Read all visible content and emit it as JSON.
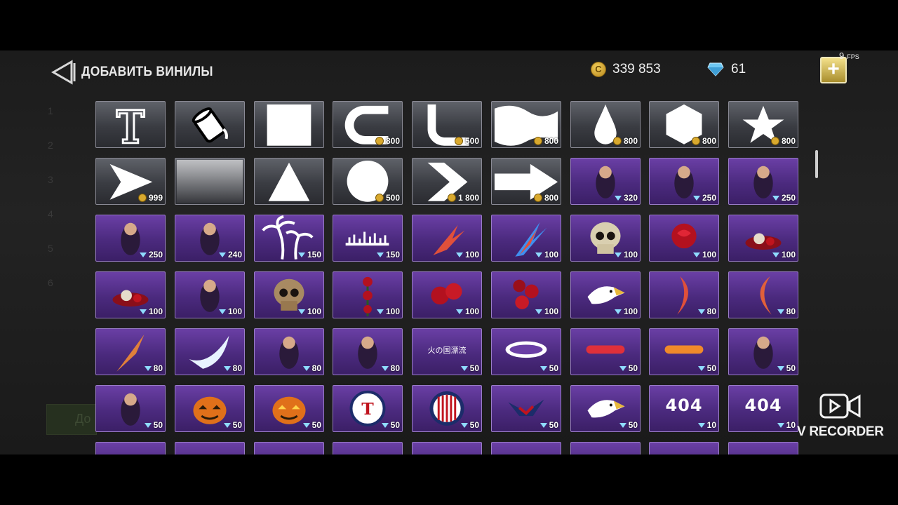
{
  "header": {
    "title": "ДОБАВИТЬ ВИНИЛЫ",
    "coins": "339 853",
    "gems": "61",
    "add_label": "+"
  },
  "fps": {
    "value": "9",
    "unit": "FPS"
  },
  "background": {
    "numbers": [
      "1",
      "2",
      "3",
      "4",
      "5",
      "6"
    ],
    "button_label": "До"
  },
  "recorder": {
    "label": "V RECORDER"
  },
  "colors": {
    "tile_purple": "#4b2a7e",
    "tile_grey": "#3a3c42",
    "coin": "#d9a92e",
    "gem": "#8fdcff",
    "add_button": "#c9b24a"
  },
  "rows": [
    [
      {
        "icon": "text-shape-icon",
        "currency": "none",
        "price": ""
      },
      {
        "icon": "paint-bucket-icon",
        "currency": "none",
        "price": ""
      },
      {
        "icon": "square-icon",
        "currency": "none",
        "price": ""
      },
      {
        "icon": "c-shape-icon",
        "currency": "coin",
        "price": "800"
      },
      {
        "icon": "l-shape-icon",
        "currency": "coin",
        "price": "500"
      },
      {
        "icon": "flag-wave-icon",
        "currency": "coin",
        "price": "800"
      },
      {
        "icon": "drop-icon",
        "currency": "coin",
        "price": "800"
      },
      {
        "icon": "hexagon-icon",
        "currency": "coin",
        "price": "800"
      },
      {
        "icon": "star-icon",
        "currency": "coin",
        "price": "800"
      }
    ],
    [
      {
        "icon": "arrowhead-icon",
        "currency": "coin",
        "price": "999"
      },
      {
        "icon": "gradient-icon",
        "currency": "none",
        "price": ""
      },
      {
        "icon": "triangle-icon",
        "currency": "none",
        "price": ""
      },
      {
        "icon": "circle-icon",
        "currency": "coin",
        "price": "500"
      },
      {
        "icon": "chevron-icon",
        "currency": "coin",
        "price": "1 800"
      },
      {
        "icon": "arrow-right-icon",
        "currency": "coin",
        "price": "800"
      },
      {
        "icon": "anime-girl-icon",
        "currency": "gem",
        "price": "320"
      },
      {
        "icon": "woman-figure-icon",
        "currency": "gem",
        "price": "250"
      },
      {
        "icon": "man-figure-icon",
        "currency": "gem",
        "price": "250"
      }
    ],
    [
      {
        "icon": "pinup-girl-icon",
        "currency": "gem",
        "price": "250"
      },
      {
        "icon": "fairy-icon",
        "currency": "gem",
        "price": "240"
      },
      {
        "icon": "palm-trees-icon",
        "currency": "gem",
        "price": "150"
      },
      {
        "icon": "city-skyline-icon",
        "currency": "gem",
        "price": "150"
      },
      {
        "icon": "paint-splash-icon",
        "currency": "gem",
        "price": "100"
      },
      {
        "icon": "blue-splash-icon",
        "currency": "gem",
        "price": "100"
      },
      {
        "icon": "skull-icon",
        "currency": "gem",
        "price": "100"
      },
      {
        "icon": "rose-icon",
        "currency": "gem",
        "price": "100"
      },
      {
        "icon": "rose-skull-icon",
        "currency": "gem",
        "price": "100"
      }
    ],
    [
      {
        "icon": "skull-roses-icon",
        "currency": "gem",
        "price": "100"
      },
      {
        "icon": "zombie-woman-icon",
        "currency": "gem",
        "price": "100"
      },
      {
        "icon": "skull-brown-icon",
        "currency": "gem",
        "price": "100"
      },
      {
        "icon": "rose-stem-icon",
        "currency": "gem",
        "price": "100"
      },
      {
        "icon": "roses-pair-icon",
        "currency": "gem",
        "price": "100"
      },
      {
        "icon": "roses-bunch-icon",
        "currency": "gem",
        "price": "100"
      },
      {
        "icon": "eagle-head-icon",
        "currency": "gem",
        "price": "100"
      },
      {
        "icon": "crescent-icon",
        "currency": "gem",
        "price": "80"
      },
      {
        "icon": "crescent-left-icon",
        "currency": "gem",
        "price": "80"
      }
    ],
    [
      {
        "icon": "flame-streak-icon",
        "currency": "gem",
        "price": "80"
      },
      {
        "icon": "wave-splash-icon",
        "currency": "gem",
        "price": "80"
      },
      {
        "icon": "cyber-cat-icon",
        "currency": "gem",
        "price": "80"
      },
      {
        "icon": "cyber-man-icon",
        "currency": "gem",
        "price": "80"
      },
      {
        "icon": "kanji-text-icon",
        "currency": "gem",
        "price": "50",
        "text": "火の国漂流"
      },
      {
        "icon": "graffiti-logo-icon",
        "currency": "gem",
        "price": "50"
      },
      {
        "icon": "graffiti-red-icon",
        "currency": "gem",
        "price": "50"
      },
      {
        "icon": "graffiti-orange-icon",
        "currency": "gem",
        "price": "50"
      },
      {
        "icon": "joker-icon",
        "currency": "gem",
        "price": "50"
      }
    ],
    [
      {
        "icon": "blue-monster-icon",
        "currency": "gem",
        "price": "50"
      },
      {
        "icon": "pumpkin-icon",
        "currency": "gem",
        "price": "50"
      },
      {
        "icon": "jack-o-lantern-icon",
        "currency": "gem",
        "price": "50"
      },
      {
        "icon": "team-badge-icon",
        "currency": "gem",
        "price": "50"
      },
      {
        "icon": "flag-badge-icon",
        "currency": "gem",
        "price": "50"
      },
      {
        "icon": "eagle-flag-icon",
        "currency": "gem",
        "price": "50"
      },
      {
        "icon": "bald-eagle-icon",
        "currency": "gem",
        "price": "50"
      },
      {
        "icon": "text-404-icon",
        "currency": "gem",
        "price": "10",
        "text": "404"
      },
      {
        "icon": "text-404-icon",
        "currency": "gem",
        "price": "10",
        "text": "404"
      }
    ],
    [
      {
        "icon": "partial-icon",
        "currency": "none",
        "price": ""
      },
      {
        "icon": "partial-icon",
        "currency": "none",
        "price": ""
      },
      {
        "icon": "partial-icon",
        "currency": "none",
        "price": ""
      },
      {
        "icon": "partial-icon",
        "currency": "none",
        "price": ""
      },
      {
        "icon": "partial-icon",
        "currency": "none",
        "price": ""
      },
      {
        "icon": "partial-icon",
        "currency": "none",
        "price": ""
      },
      {
        "icon": "partial-icon",
        "currency": "none",
        "price": ""
      },
      {
        "icon": "partial-icon",
        "currency": "none",
        "price": ""
      },
      {
        "icon": "partial-icon",
        "currency": "none",
        "price": ""
      }
    ]
  ]
}
